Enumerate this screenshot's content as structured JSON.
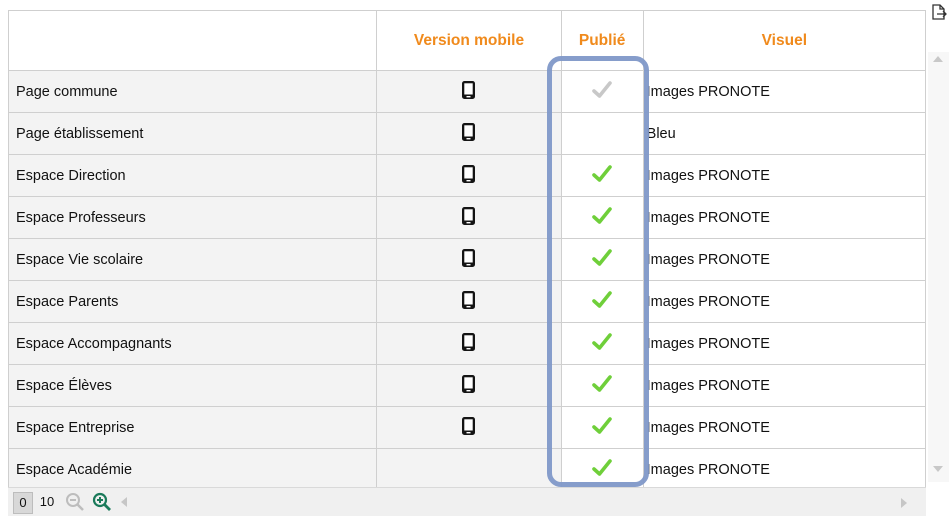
{
  "table": {
    "headers": {
      "name": "",
      "mobile": "Version mobile",
      "published": "Publié",
      "visual": "Visuel"
    },
    "rows": [
      {
        "name": "Page commune",
        "mobile": true,
        "published": "disabled",
        "visual": "Images PRONOTE"
      },
      {
        "name": "Page établissement",
        "mobile": true,
        "published": "none",
        "visual": "Bleu"
      },
      {
        "name": "Espace Direction",
        "mobile": true,
        "published": "checked",
        "visual": "Images PRONOTE"
      },
      {
        "name": "Espace Professeurs",
        "mobile": true,
        "published": "checked",
        "visual": "Images PRONOTE"
      },
      {
        "name": "Espace Vie scolaire",
        "mobile": true,
        "published": "checked",
        "visual": "Images PRONOTE"
      },
      {
        "name": "Espace Parents",
        "mobile": true,
        "published": "checked",
        "visual": "Images PRONOTE"
      },
      {
        "name": "Espace Accompagnants",
        "mobile": true,
        "published": "checked",
        "visual": "Images PRONOTE"
      },
      {
        "name": "Espace Élèves",
        "mobile": true,
        "published": "checked",
        "visual": "Images PRONOTE"
      },
      {
        "name": "Espace Entreprise",
        "mobile": true,
        "published": "checked",
        "visual": "Images PRONOTE"
      },
      {
        "name": "Espace Académie",
        "mobile": false,
        "published": "checked",
        "visual": "Images PRONOTE"
      }
    ]
  },
  "footer": {
    "page_current": "0",
    "page_size": "10",
    "zoom_out_icon": "zoom-out-icon",
    "zoom_in_icon": "zoom-in-icon"
  },
  "icons": {
    "mobile": "mobile-phone-icon",
    "check": "check-icon",
    "export": "export-icon"
  },
  "colors": {
    "header_text": "#f08a1c",
    "check_green": "#6fcf3a",
    "check_disabled": "#c8c8c8",
    "highlight": "#7f98c8"
  }
}
